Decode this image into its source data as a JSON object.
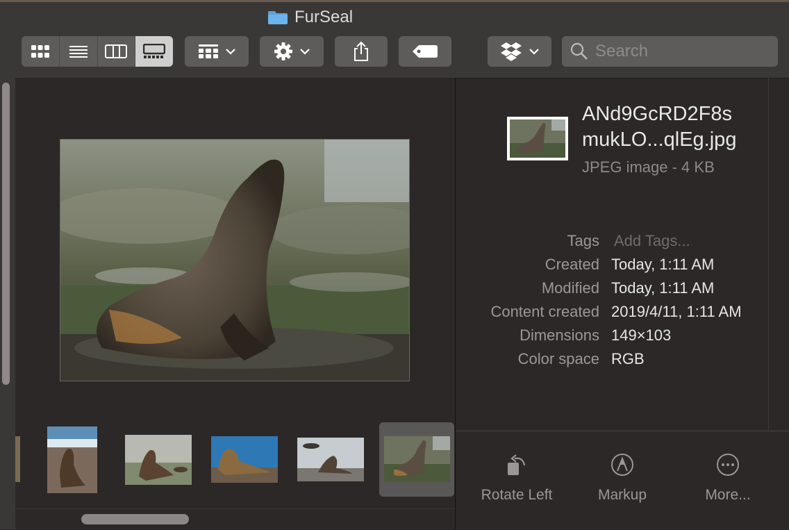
{
  "window": {
    "title": "FurSeal"
  },
  "toolbar": {
    "view_modes": [
      "icon-view",
      "list-view",
      "column-view",
      "gallery-view"
    ],
    "selected_view": "gallery-view",
    "buttons": [
      "group-by",
      "action-gear",
      "share",
      "tags",
      "dropbox"
    ]
  },
  "search": {
    "placeholder": "Search",
    "value": ""
  },
  "preview": {
    "subject": "fur seal photo",
    "thumbnails_count": 6,
    "selected_thumbnail": 5
  },
  "info": {
    "file_name_line1": "ANd9GcRD2F8s",
    "file_name_line2": "mukLO...qlEg.jpg",
    "kind": "JPEG image - 4 KB",
    "rows": [
      {
        "key": "Tags",
        "value": "Add Tags..."
      },
      {
        "key": "Created",
        "value": "Today, 1:11 AM"
      },
      {
        "key": "Modified",
        "value": "Today, 1:11 AM"
      },
      {
        "key": "Content created",
        "value": "2019/4/11, 1:11 AM"
      },
      {
        "key": "Dimensions",
        "value": "149×103"
      },
      {
        "key": "Color space",
        "value": "RGB"
      }
    ]
  },
  "actions": [
    {
      "label": "Rotate Left",
      "icon": "rotate-left-icon"
    },
    {
      "label": "Markup",
      "icon": "markup-icon"
    },
    {
      "label": "More...",
      "icon": "more-icon"
    }
  ],
  "colors": {
    "window_bg": "#2b2827",
    "toolbar_bg": "#3a3837",
    "button_bg": "#5e5c5b",
    "selected_segment": "#cfcfcf",
    "folder_blue": "#5aa2dc"
  }
}
